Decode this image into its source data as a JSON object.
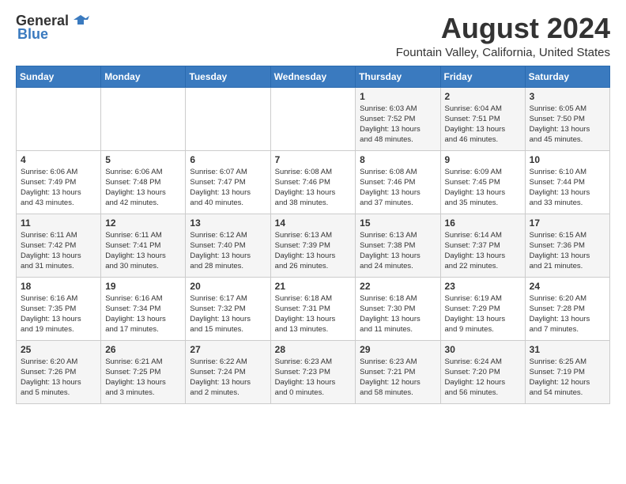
{
  "logo": {
    "general": "General",
    "blue": "Blue"
  },
  "title": "August 2024",
  "location": "Fountain Valley, California, United States",
  "weekdays": [
    "Sunday",
    "Monday",
    "Tuesday",
    "Wednesday",
    "Thursday",
    "Friday",
    "Saturday"
  ],
  "weeks": [
    [
      {
        "day": "",
        "info": ""
      },
      {
        "day": "",
        "info": ""
      },
      {
        "day": "",
        "info": ""
      },
      {
        "day": "",
        "info": ""
      },
      {
        "day": "1",
        "info": "Sunrise: 6:03 AM\nSunset: 7:52 PM\nDaylight: 13 hours\nand 48 minutes."
      },
      {
        "day": "2",
        "info": "Sunrise: 6:04 AM\nSunset: 7:51 PM\nDaylight: 13 hours\nand 46 minutes."
      },
      {
        "day": "3",
        "info": "Sunrise: 6:05 AM\nSunset: 7:50 PM\nDaylight: 13 hours\nand 45 minutes."
      }
    ],
    [
      {
        "day": "4",
        "info": "Sunrise: 6:06 AM\nSunset: 7:49 PM\nDaylight: 13 hours\nand 43 minutes."
      },
      {
        "day": "5",
        "info": "Sunrise: 6:06 AM\nSunset: 7:48 PM\nDaylight: 13 hours\nand 42 minutes."
      },
      {
        "day": "6",
        "info": "Sunrise: 6:07 AM\nSunset: 7:47 PM\nDaylight: 13 hours\nand 40 minutes."
      },
      {
        "day": "7",
        "info": "Sunrise: 6:08 AM\nSunset: 7:46 PM\nDaylight: 13 hours\nand 38 minutes."
      },
      {
        "day": "8",
        "info": "Sunrise: 6:08 AM\nSunset: 7:46 PM\nDaylight: 13 hours\nand 37 minutes."
      },
      {
        "day": "9",
        "info": "Sunrise: 6:09 AM\nSunset: 7:45 PM\nDaylight: 13 hours\nand 35 minutes."
      },
      {
        "day": "10",
        "info": "Sunrise: 6:10 AM\nSunset: 7:44 PM\nDaylight: 13 hours\nand 33 minutes."
      }
    ],
    [
      {
        "day": "11",
        "info": "Sunrise: 6:11 AM\nSunset: 7:42 PM\nDaylight: 13 hours\nand 31 minutes."
      },
      {
        "day": "12",
        "info": "Sunrise: 6:11 AM\nSunset: 7:41 PM\nDaylight: 13 hours\nand 30 minutes."
      },
      {
        "day": "13",
        "info": "Sunrise: 6:12 AM\nSunset: 7:40 PM\nDaylight: 13 hours\nand 28 minutes."
      },
      {
        "day": "14",
        "info": "Sunrise: 6:13 AM\nSunset: 7:39 PM\nDaylight: 13 hours\nand 26 minutes."
      },
      {
        "day": "15",
        "info": "Sunrise: 6:13 AM\nSunset: 7:38 PM\nDaylight: 13 hours\nand 24 minutes."
      },
      {
        "day": "16",
        "info": "Sunrise: 6:14 AM\nSunset: 7:37 PM\nDaylight: 13 hours\nand 22 minutes."
      },
      {
        "day": "17",
        "info": "Sunrise: 6:15 AM\nSunset: 7:36 PM\nDaylight: 13 hours\nand 21 minutes."
      }
    ],
    [
      {
        "day": "18",
        "info": "Sunrise: 6:16 AM\nSunset: 7:35 PM\nDaylight: 13 hours\nand 19 minutes."
      },
      {
        "day": "19",
        "info": "Sunrise: 6:16 AM\nSunset: 7:34 PM\nDaylight: 13 hours\nand 17 minutes."
      },
      {
        "day": "20",
        "info": "Sunrise: 6:17 AM\nSunset: 7:32 PM\nDaylight: 13 hours\nand 15 minutes."
      },
      {
        "day": "21",
        "info": "Sunrise: 6:18 AM\nSunset: 7:31 PM\nDaylight: 13 hours\nand 13 minutes."
      },
      {
        "day": "22",
        "info": "Sunrise: 6:18 AM\nSunset: 7:30 PM\nDaylight: 13 hours\nand 11 minutes."
      },
      {
        "day": "23",
        "info": "Sunrise: 6:19 AM\nSunset: 7:29 PM\nDaylight: 13 hours\nand 9 minutes."
      },
      {
        "day": "24",
        "info": "Sunrise: 6:20 AM\nSunset: 7:28 PM\nDaylight: 13 hours\nand 7 minutes."
      }
    ],
    [
      {
        "day": "25",
        "info": "Sunrise: 6:20 AM\nSunset: 7:26 PM\nDaylight: 13 hours\nand 5 minutes."
      },
      {
        "day": "26",
        "info": "Sunrise: 6:21 AM\nSunset: 7:25 PM\nDaylight: 13 hours\nand 3 minutes."
      },
      {
        "day": "27",
        "info": "Sunrise: 6:22 AM\nSunset: 7:24 PM\nDaylight: 13 hours\nand 2 minutes."
      },
      {
        "day": "28",
        "info": "Sunrise: 6:23 AM\nSunset: 7:23 PM\nDaylight: 13 hours\nand 0 minutes."
      },
      {
        "day": "29",
        "info": "Sunrise: 6:23 AM\nSunset: 7:21 PM\nDaylight: 12 hours\nand 58 minutes."
      },
      {
        "day": "30",
        "info": "Sunrise: 6:24 AM\nSunset: 7:20 PM\nDaylight: 12 hours\nand 56 minutes."
      },
      {
        "day": "31",
        "info": "Sunrise: 6:25 AM\nSunset: 7:19 PM\nDaylight: 12 hours\nand 54 minutes."
      }
    ]
  ]
}
